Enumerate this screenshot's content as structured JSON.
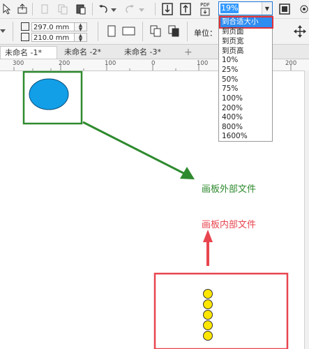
{
  "toolbar": {
    "buttons": [
      "pointer-icon",
      "publish-icon",
      "cut-icon",
      "copy-icon",
      "paste-icon",
      "undo-icon",
      "redo-icon",
      "import-icon",
      "export-icon",
      "pdf-icon"
    ],
    "pdf_label": "PDF",
    "zoom_value": "19%",
    "fullscreen": "fullscreen-icon"
  },
  "property_bar": {
    "width_value": "297.0 mm",
    "height_value": "210.0 mm",
    "units_label": "单位：",
    "spin_up": "▲",
    "spin_down": "▼"
  },
  "zoom_dropdown": {
    "options": [
      "到合适大小",
      "到页面",
      "到页宽",
      "到页高",
      "10%",
      "25%",
      "50%",
      "75%",
      "100%",
      "200%",
      "400%",
      "800%",
      "1600%"
    ],
    "selected": "到合适大小"
  },
  "tabs": [
    {
      "label": "未命名 -1*",
      "active": true
    },
    {
      "label": "未命名 -2*",
      "active": false
    },
    {
      "label": "未命名 -3*",
      "active": false
    }
  ],
  "add_tab_label": "+",
  "ruler": {
    "labels": [
      "300",
      "200",
      "100",
      "0",
      "100",
      "200"
    ]
  },
  "canvas": {
    "outside_label": "画板外部文件",
    "inside_label": "画板内部文件",
    "colors": {
      "green": "#2e8a2e",
      "red": "#e8454f",
      "blue_ellipse": "#129fe8",
      "yellow_circle": "#ffe600"
    }
  }
}
